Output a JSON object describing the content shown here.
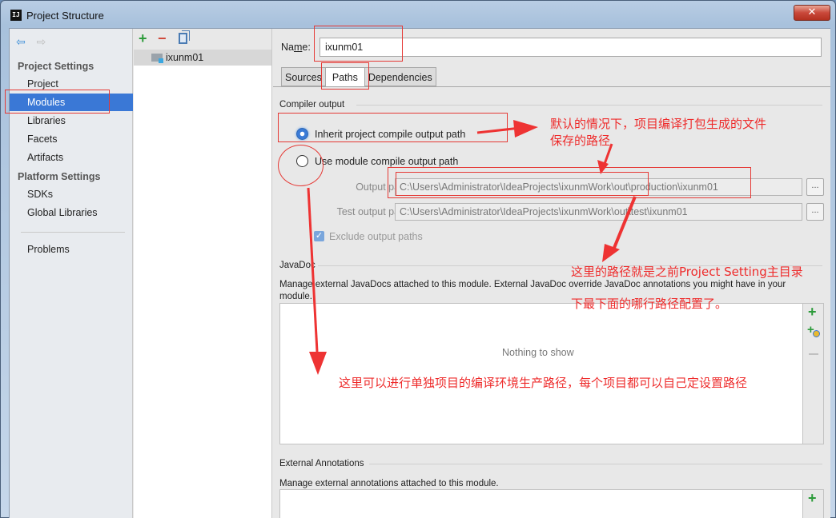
{
  "window": {
    "app_icon": "IJ",
    "title": "Project Structure",
    "close_glyph": "✕"
  },
  "nav": {
    "back_icon": "⇦",
    "forward_icon": "⇨",
    "sections": [
      {
        "heading": "Project Settings",
        "items": [
          "Project",
          "Modules",
          "Libraries",
          "Facets",
          "Artifacts"
        ]
      },
      {
        "heading": "Platform Settings",
        "items": [
          "SDKs",
          "Global Libraries"
        ]
      }
    ],
    "selected": "Modules",
    "bottom_item": "Problems"
  },
  "module_list": {
    "add_glyph": "+",
    "remove_glyph": "−",
    "modules": [
      "ixunm01"
    ]
  },
  "detail": {
    "name_label_pre": "Na",
    "name_label_underlined": "m",
    "name_label_post": "e:",
    "name_value": "ixunm01",
    "tabs": [
      "Sources",
      "Paths",
      "Dependencies"
    ],
    "active_tab": "Paths",
    "compiler_output": {
      "title": "Compiler output",
      "inherit_label": "Inherit project compile output path",
      "use_module_label": "Use module compile output path",
      "selected": "inherit",
      "output_path_label": "Output path:",
      "output_path_value": "C:\\Users\\Administrator\\IdeaProjects\\ixunmWork\\out\\production\\ixunm01",
      "test_output_path_label": "Test output path:",
      "test_output_path_value": "C:\\Users\\Administrator\\IdeaProjects\\ixunmWork\\out\\test\\ixunm01",
      "browse_glyph": "...",
      "exclude_label": "Exclude output paths",
      "exclude_checked": true
    },
    "javadoc": {
      "title": "JavaDoc",
      "description": "Manage external JavaDocs attached to this module. External JavaDoc override JavaDoc annotations you might have in your module.",
      "empty_text": "Nothing to show"
    },
    "external_annotations": {
      "title": "External Annotations",
      "description": "Manage external annotations attached to this module."
    }
  },
  "annotations": {
    "note1_line1": "默认的情况下，项目编译打包生成的文件",
    "note1_line2": "保存的路径",
    "note2_line1": "这里的路径就是之前Project Setting主目录",
    "note2_line2": "下最下面的哪行路径配置了。",
    "note3": "这里可以进行单独项目的编译环境生产路径，每个项目都可以自己定设置路径",
    "color": "#ee2b2b"
  }
}
